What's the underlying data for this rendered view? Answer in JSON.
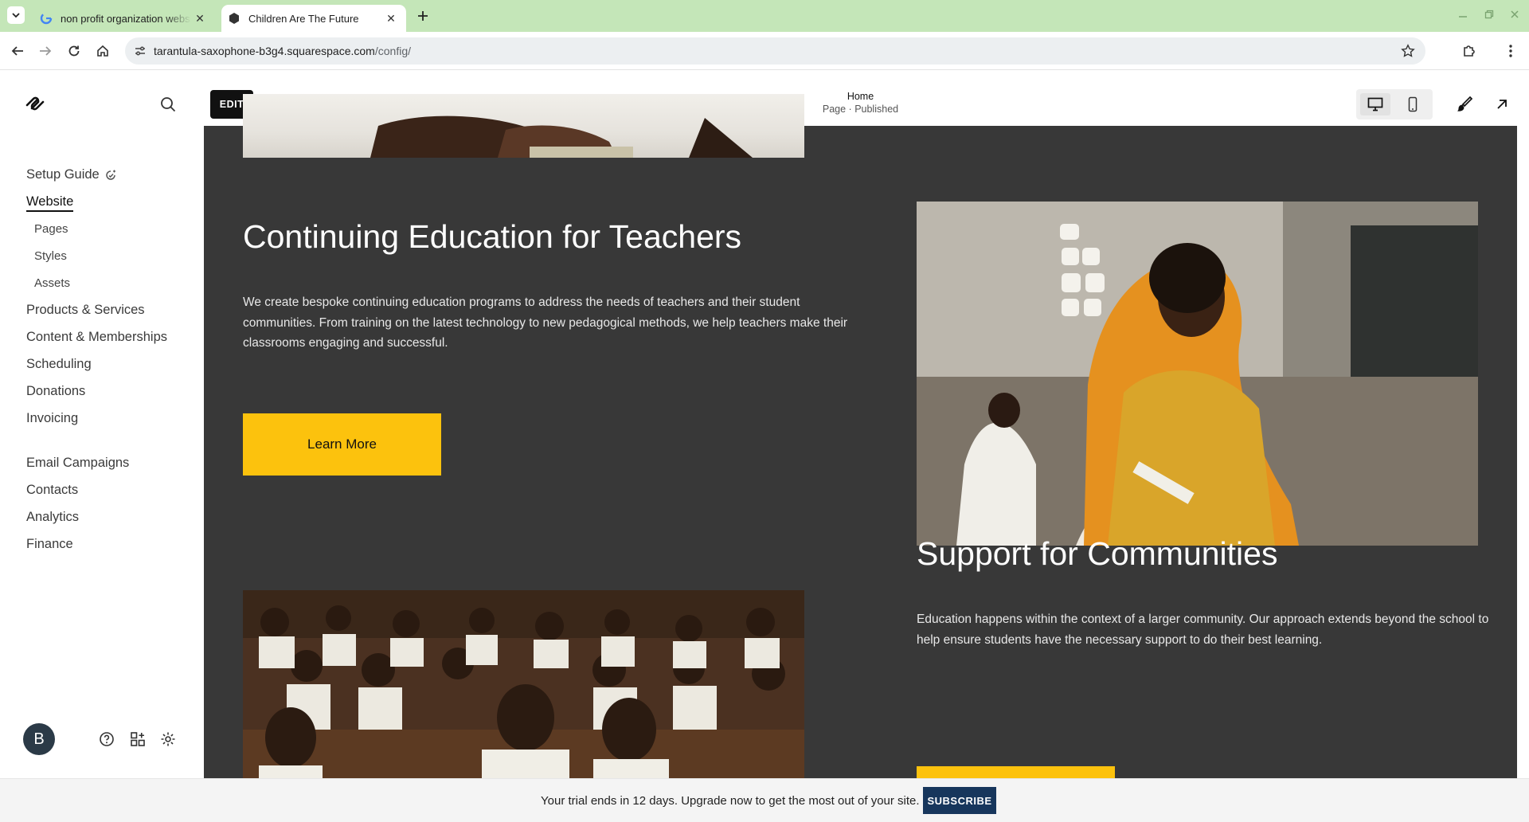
{
  "browser": {
    "tabs": [
      {
        "title": "non profit organization website",
        "favicon": "google-g-icon",
        "active": false
      },
      {
        "title": "Children Are The Future",
        "favicon": "squarespace-icon",
        "active": true
      }
    ],
    "url_host": "tarantula-saxophone-b3g4.squarespace.com",
    "url_path": "/config/"
  },
  "sidebar": {
    "setup_guide": "Setup Guide",
    "website": "Website",
    "website_sub": [
      "Pages",
      "Styles",
      "Assets"
    ],
    "group1": [
      "Products & Services",
      "Content & Memberships",
      "Scheduling",
      "Donations",
      "Invoicing"
    ],
    "group2": [
      "Email Campaigns",
      "Contacts",
      "Analytics",
      "Finance"
    ],
    "avatar_initial": "B"
  },
  "editor": {
    "edit_label": "EDIT",
    "page_name": "Home",
    "page_status": "Page · Published"
  },
  "content": {
    "section1": {
      "title": "Continuing Education for Teachers",
      "body": "We create bespoke continuing education programs to address the needs of teachers and their student communities. From training on the latest technology to new pedagogical methods, we help teachers make their classrooms engaging and successful.",
      "button": "Learn More"
    },
    "section2": {
      "title": "Support for Communities",
      "body": "Education happens within the context of a larger community. Our approach extends beyond the school to help ensure students have the necessary support to do their best learning."
    }
  },
  "trial": {
    "text": "Your trial ends in 12 days. Upgrade now to get the most out of your site.",
    "button": "SUBSCRIBE"
  },
  "colors": {
    "tabbar": "#c4e6b8",
    "canvas": "#383838",
    "cta": "#fcc20d",
    "subscribe": "#17365c"
  }
}
